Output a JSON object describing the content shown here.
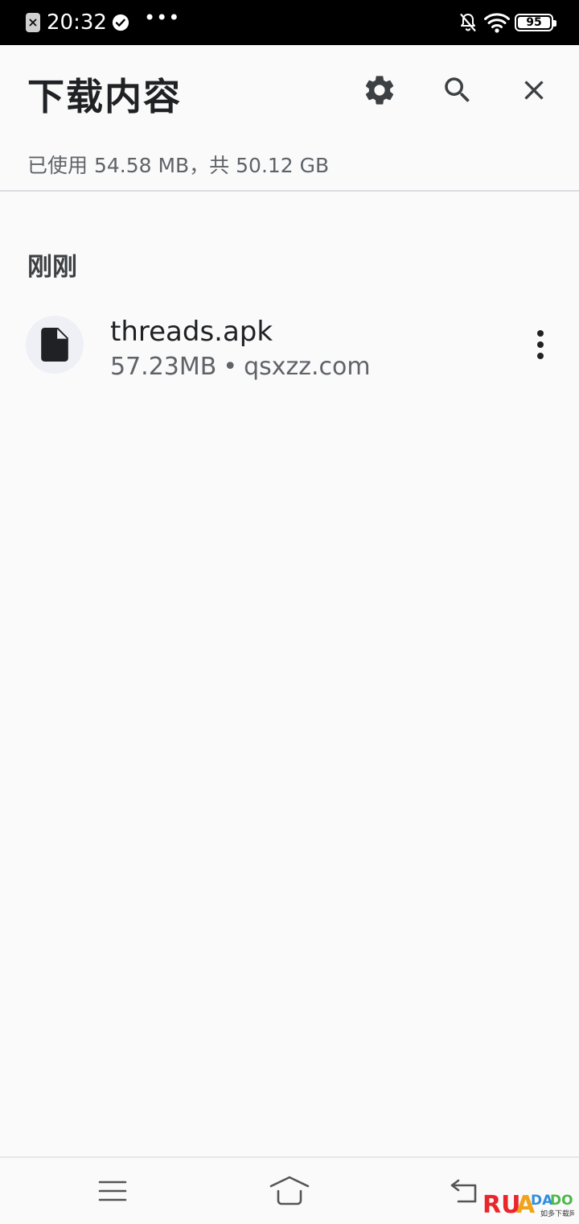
{
  "status_bar": {
    "time": "20:32",
    "dots": "•••",
    "battery": "95",
    "icons": [
      "app-notification-icon",
      "check-circle-icon",
      "bell-off-icon",
      "wifi-icon",
      "battery-icon"
    ]
  },
  "header": {
    "title": "下载内容",
    "actions": [
      "settings-icon",
      "search-icon",
      "close-icon"
    ]
  },
  "storage": {
    "text": "已使用 54.58 MB，共 50.12 GB"
  },
  "sections": [
    {
      "header": "刚刚",
      "items": [
        {
          "name": "threads.apk",
          "size": "57.23MB",
          "separator": "•",
          "source": "qsxzz.com",
          "icon": "file-icon"
        }
      ]
    }
  ],
  "nav_bar": {
    "icons": [
      "menu-icon",
      "home-icon",
      "back-icon"
    ]
  },
  "watermark": {
    "text": "RUAN DADO 如多下载网"
  },
  "colors": {
    "background": "#fafafa",
    "status_bar": "#000000",
    "icon": "#3c4043",
    "text_primary": "#202124",
    "text_secondary": "#5f6368"
  }
}
